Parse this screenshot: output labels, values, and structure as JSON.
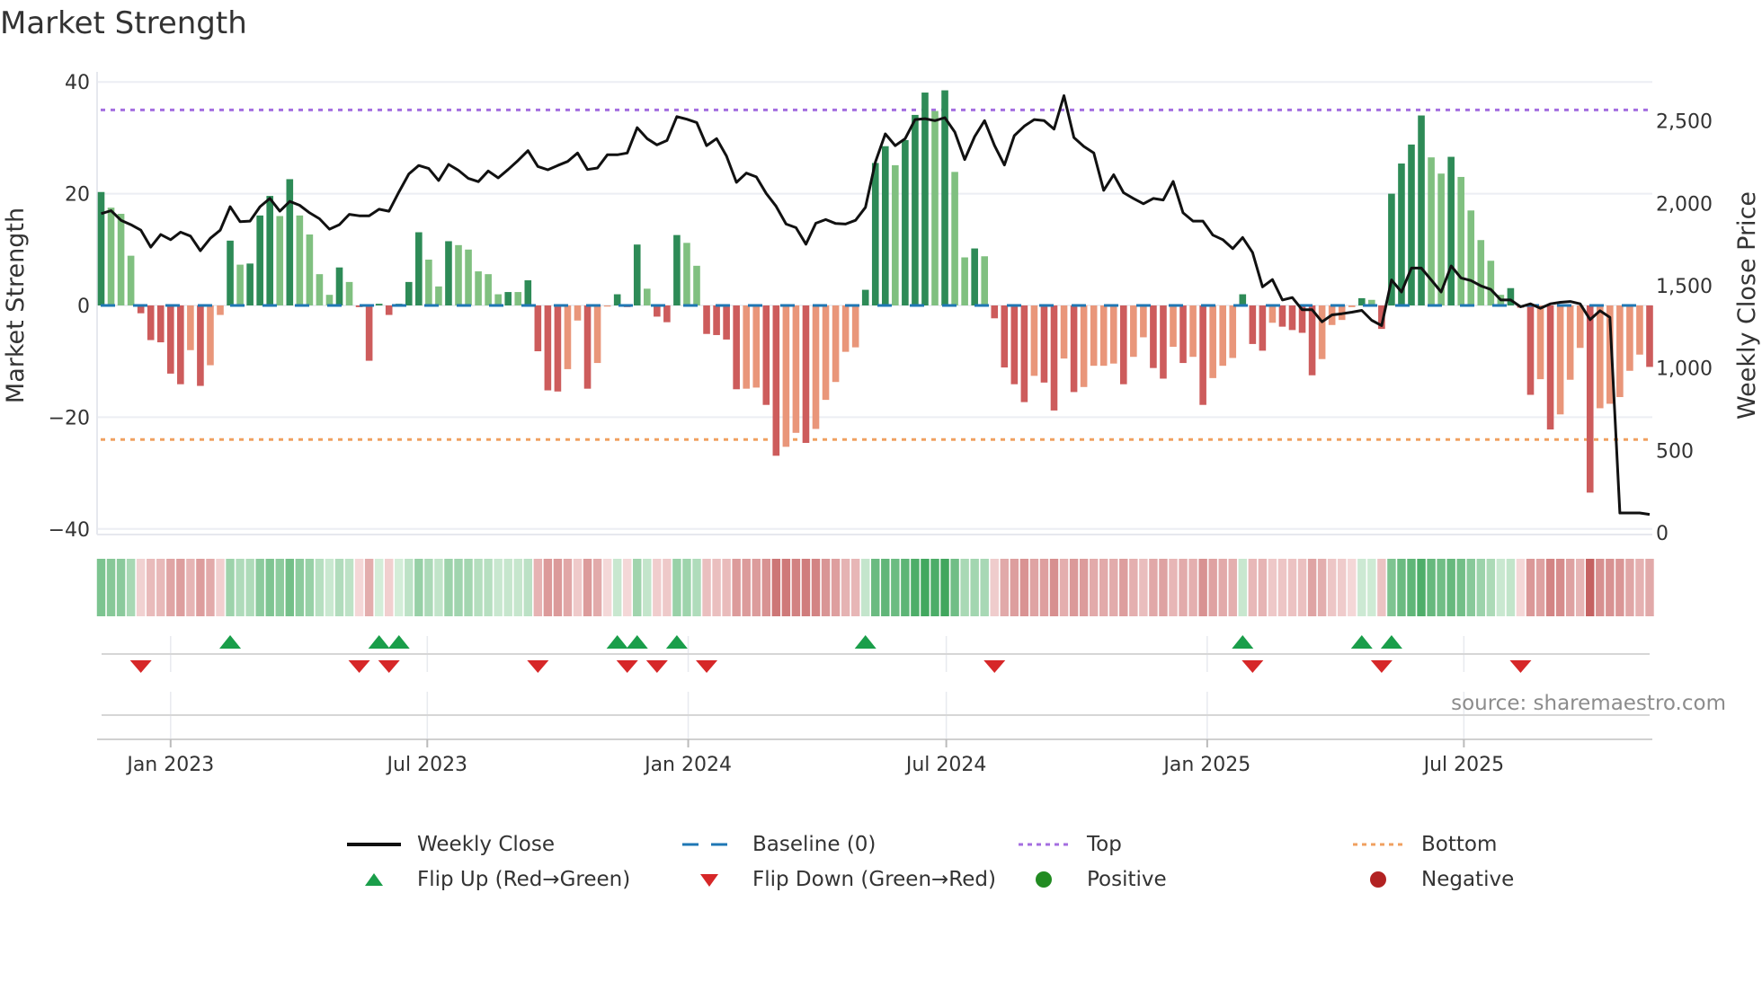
{
  "title": "Market Strength",
  "source": "source: sharemaestro.com",
  "legend": [
    {
      "label": "Weekly Close",
      "symbol": "line",
      "color": "#111111"
    },
    {
      "label": "Baseline (0)",
      "symbol": "dash",
      "color": "#1f77b4"
    },
    {
      "label": "Top",
      "symbol": "dot",
      "color": "#a46ee0"
    },
    {
      "label": "Bottom",
      "symbol": "dot",
      "color": "#f0a060"
    },
    {
      "label": "Flip Up (Red→Green)",
      "symbol": "triangle-up",
      "color": "#1a9e4a"
    },
    {
      "label": "Flip Down (Green→Red)",
      "symbol": "triangle-down",
      "color": "#d62728"
    },
    {
      "label": "Positive",
      "symbol": "circle",
      "color": "#228b22"
    },
    {
      "label": "Negative",
      "symbol": "circle",
      "color": "#b22222"
    }
  ],
  "chart_data": {
    "type": "bar",
    "title": "Market Strength",
    "ylabel": "Market Strength",
    "y2label": "Weekly Close Price",
    "xlabel": "",
    "frequency": "weekly",
    "start_date": "2022-11-13",
    "ylim": [
      -41,
      41
    ],
    "y2lim": [
      -10,
      2770
    ],
    "yticks": [
      40,
      20,
      0,
      -20,
      -40
    ],
    "yticklabels": [
      "40",
      "20",
      "0",
      "−20",
      "−40"
    ],
    "y2ticks": [
      2500,
      2000,
      1500,
      1000,
      500,
      0
    ],
    "y2ticklabels": [
      "2,500",
      "2,000",
      "1,500",
      "1,000",
      "500",
      "0"
    ],
    "xticks": [
      "2023-01-01",
      "2023-07-01",
      "2024-01-01",
      "2024-07-01",
      "2025-01-01",
      "2025-07-01"
    ],
    "xticklabels": [
      "Jan 2023",
      "Jul 2023",
      "Jan 2024",
      "Jul 2024",
      "Jan 2025",
      "Jul 2025"
    ],
    "top_level": 35,
    "bottom_level": -24,
    "baseline": 0,
    "colors": {
      "pos_strong": "#2e8b57",
      "pos_weak": "#80c080",
      "neg_strong": "#cd5c5c",
      "neg_weak": "#e9967a",
      "close": "#111111"
    },
    "strength": [
      20.3,
      17.5,
      16.4,
      8.9,
      -1.4,
      -6.2,
      -6.6,
      -12.2,
      -14.1,
      -8.0,
      -14.4,
      -10.7,
      -1.7,
      11.6,
      7.3,
      7.5,
      16.1,
      19.6,
      16.0,
      22.6,
      16.1,
      12.7,
      5.6,
      1.9,
      6.8,
      4.2,
      -0.3,
      -9.9,
      0.3,
      -1.7,
      0.3,
      4.2,
      13.1,
      8.2,
      3.4,
      11.5,
      10.8,
      10.0,
      6.1,
      5.6,
      2.0,
      2.4,
      2.4,
      4.5,
      -8.2,
      -15.2,
      -15.4,
      -11.4,
      -2.7,
      -14.9,
      -10.3,
      -0.2,
      2.0,
      -0.3,
      10.9,
      3.0,
      -2.0,
      -3.0,
      12.6,
      11.2,
      7.1,
      -5.1,
      -5.3,
      -6.1,
      -15.0,
      -14.9,
      -14.7,
      -17.8,
      -26.9,
      -25.3,
      -22.8,
      -24.6,
      -22.1,
      -16.9,
      -13.7,
      -8.3,
      -7.5,
      2.8,
      25.5,
      28.5,
      25.1,
      29.6,
      34.1,
      38.1,
      34.8,
      38.5,
      23.9,
      8.6,
      10.2,
      8.8,
      -2.3,
      -11.1,
      -14.1,
      -17.3,
      -12.6,
      -13.8,
      -18.8,
      -9.5,
      -15.5,
      -14.6,
      -10.8,
      -10.8,
      -10.4,
      -14.1,
      -9.2,
      -5.7,
      -11.2,
      -13.1,
      -7.4,
      -10.3,
      -9.2,
      -17.8,
      -13.0,
      -10.8,
      -9.4,
      2.0,
      -6.9,
      -8.1,
      -3.1,
      -3.8,
      -4.4,
      -4.9,
      -12.5,
      -9.6,
      -3.5,
      -2.6,
      -0.3,
      1.3,
      1.0,
      -4.2,
      20.0,
      25.4,
      28.8,
      34.0,
      26.5,
      23.6,
      26.6,
      23.0,
      17.0,
      11.7,
      8.0,
      1.9,
      3.1,
      -0.4,
      -16.0,
      -13.2,
      -22.2,
      -19.5,
      -13.3,
      -7.6,
      -33.5,
      -18.4,
      -17.6,
      -16.4,
      -11.7,
      -8.8,
      -11.0
    ],
    "weekly_close": [
      1937,
      1955,
      1897,
      1870,
      1837,
      1734,
      1810,
      1779,
      1825,
      1801,
      1712,
      1788,
      1837,
      1979,
      1888,
      1892,
      1979,
      2029,
      1952,
      2011,
      1988,
      1942,
      1906,
      1843,
      1870,
      1933,
      1924,
      1924,
      1964,
      1952,
      2069,
      2178,
      2229,
      2211,
      2138,
      2236,
      2200,
      2151,
      2131,
      2196,
      2154,
      2205,
      2260,
      2319,
      2223,
      2203,
      2229,
      2254,
      2305,
      2205,
      2214,
      2294,
      2294,
      2305,
      2459,
      2392,
      2354,
      2381,
      2526,
      2510,
      2490,
      2350,
      2392,
      2287,
      2127,
      2183,
      2160,
      2060,
      1982,
      1874,
      1852,
      1752,
      1879,
      1901,
      1877,
      1874,
      1897,
      1975,
      2251,
      2421,
      2350,
      2392,
      2508,
      2513,
      2501,
      2519,
      2432,
      2265,
      2405,
      2501,
      2350,
      2232,
      2410,
      2468,
      2508,
      2501,
      2450,
      2653,
      2399,
      2345,
      2305,
      2078,
      2173,
      2064,
      2029,
      1997,
      2029,
      2020,
      2133,
      1942,
      1892,
      1892,
      1807,
      1779,
      1725,
      1792,
      1701,
      1493,
      1537,
      1413,
      1428,
      1354,
      1354,
      1281,
      1323,
      1330,
      1339,
      1350,
      1290,
      1258,
      1535,
      1462,
      1607,
      1607,
      1535,
      1462,
      1620,
      1547,
      1531,
      1499,
      1477,
      1413,
      1413,
      1372,
      1390,
      1363,
      1390,
      1399,
      1404,
      1390,
      1294,
      1348,
      1308,
      121,
      121,
      121,
      112
    ]
  }
}
